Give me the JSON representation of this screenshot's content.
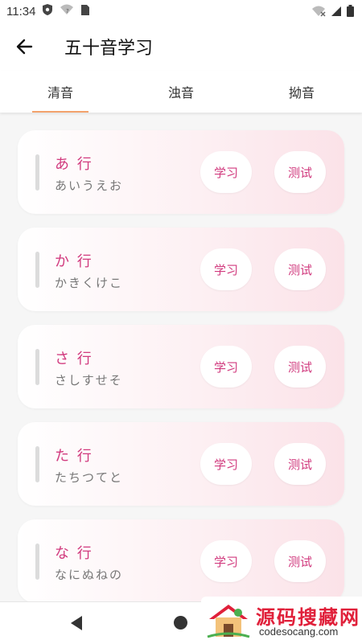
{
  "status_bar": {
    "time": "11:34",
    "icons_left": [
      "shield-icon",
      "wifi-question-icon",
      "sim-card-icon"
    ],
    "icons_right": [
      "wifi-off-icon",
      "signal-icon",
      "battery-icon"
    ]
  },
  "app_bar": {
    "back_icon": "arrow-left-icon",
    "title": "五十音学习"
  },
  "tabs": [
    {
      "label": "清音",
      "active": true
    },
    {
      "label": "浊音",
      "active": false
    },
    {
      "label": "拗音",
      "active": false
    }
  ],
  "accent_colors": {
    "tab_underline": "#f3a26c",
    "row_text": "#d13a7e",
    "card_gradient_end": "#fbe2e8"
  },
  "rows": [
    {
      "title": "あ 行",
      "kana": "あいうえお",
      "learn": "学习",
      "test": "测试"
    },
    {
      "title": "か 行",
      "kana": "かきくけこ",
      "learn": "学习",
      "test": "测试"
    },
    {
      "title": "さ 行",
      "kana": "さしすせそ",
      "learn": "学习",
      "test": "测试"
    },
    {
      "title": "た 行",
      "kana": "たちつてと",
      "learn": "学习",
      "test": "测试"
    },
    {
      "title": "な 行",
      "kana": "なにぬねの",
      "learn": "学习",
      "test": "测试"
    }
  ],
  "nav_bar": {
    "back_icon": "triangle-back-icon",
    "home_icon": "circle-home-icon"
  },
  "watermark": {
    "brand_cn": "源码搜藏网",
    "brand_en": "codesocang.com"
  }
}
